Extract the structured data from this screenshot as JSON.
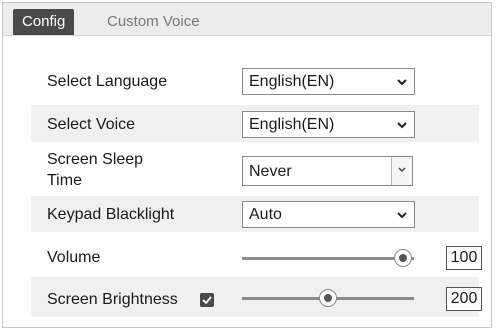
{
  "tabs": {
    "config": "Config",
    "custom_voice": "Custom Voice"
  },
  "rows": {
    "language": {
      "label": "Select Language",
      "value": "English(EN)"
    },
    "voice": {
      "label": "Select Voice",
      "value": "English(EN)"
    },
    "sleep": {
      "label_line1": "Screen Sleep",
      "label_line2": "Time",
      "value": "Never"
    },
    "blacklight": {
      "label": "Keypad Blacklight",
      "value": "Auto"
    },
    "volume": {
      "label": "Volume",
      "value": "100",
      "level": 1.0
    },
    "brightness": {
      "label": "Screen Brightness",
      "value": "200",
      "level": 0.5,
      "checked": true
    }
  },
  "icons": {
    "dropdown": "chevron-down-icon",
    "checkbox": "checkmark-icon"
  },
  "colors": {
    "active_tab": "#4a4a4a",
    "row_stripe": "#f0f0f0"
  }
}
